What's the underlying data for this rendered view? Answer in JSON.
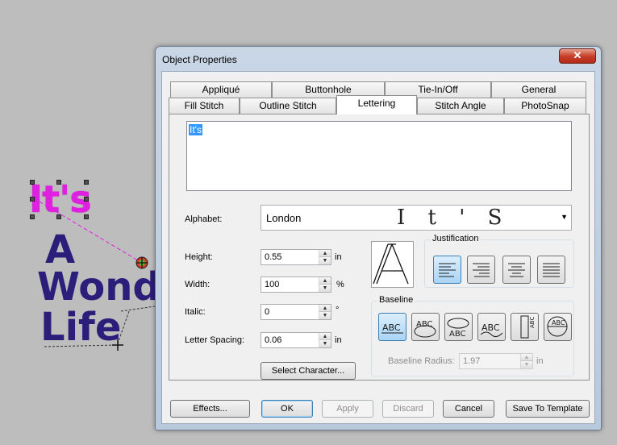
{
  "canvas": {
    "its_text": "It's",
    "line2": "A",
    "line3": "Wond",
    "line4": "Life"
  },
  "dialog": {
    "title": "Object Properties",
    "close_glyph": "✕",
    "tabs_row1": [
      "Appliqué",
      "Buttonhole",
      "Tie-In/Off",
      "General"
    ],
    "tabs_row2": [
      "Fill Stitch",
      "Outline Stitch",
      "Lettering",
      "Stitch Angle",
      "PhotoSnap"
    ],
    "active_tab": "Lettering",
    "text_value": "It's",
    "alphabet_label": "Alphabet:",
    "alphabet_value": "London",
    "alphabet_preview": "I t ' S",
    "height_label": "Height:",
    "height_value": "0.55",
    "height_unit": "in",
    "width_label": "Width:",
    "width_value": "100",
    "width_unit": "%",
    "italic_label": "Italic:",
    "italic_value": "0",
    "italic_unit": "°",
    "spacing_label": "Letter Spacing:",
    "spacing_value": "0.06",
    "spacing_unit": "in",
    "select_character": "Select Character...",
    "glyph_preview": "A",
    "justification_label": "Justification",
    "baseline_label": "Baseline",
    "baseline_radius_label": "Baseline Radius:",
    "baseline_radius_value": "1.97",
    "baseline_radius_unit": "in",
    "baseline_btn_texts": [
      "ABC",
      "ABC",
      "ABC",
      "ABC",
      "ABC",
      "ABC"
    ],
    "buttons": {
      "effects": "Effects...",
      "ok": "OK",
      "apply": "Apply",
      "discard": "Discard",
      "cancel": "Cancel",
      "save_template": "Save To Template"
    }
  }
}
